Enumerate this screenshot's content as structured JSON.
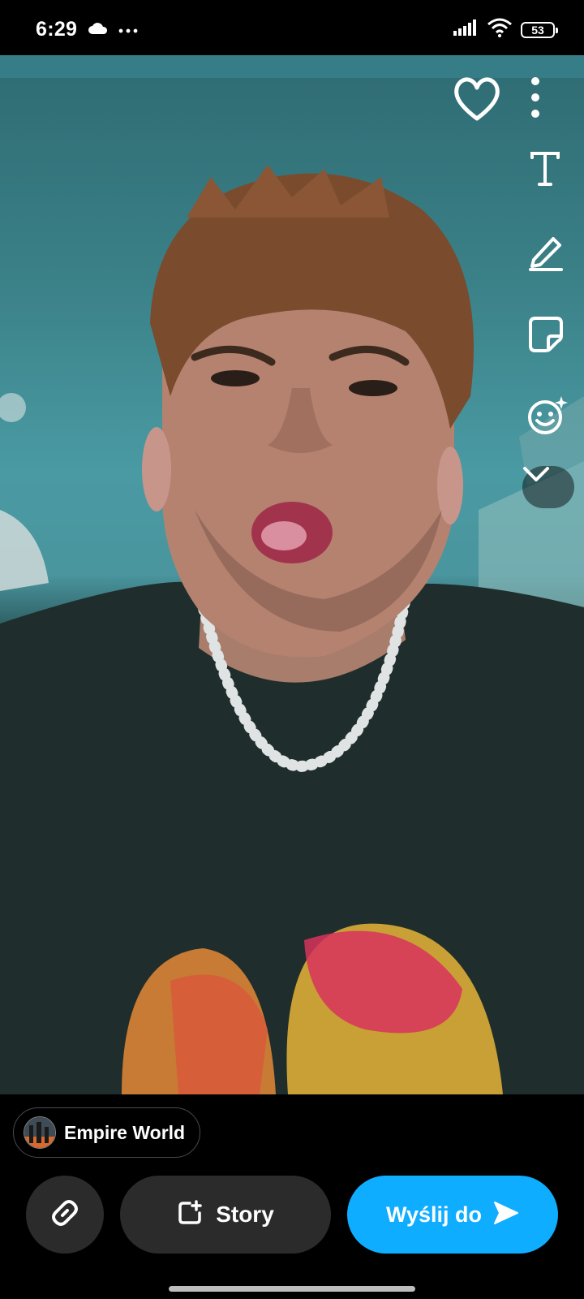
{
  "status_bar": {
    "time": "6:29",
    "battery": "53",
    "icons": [
      "cloud-icon",
      "more-dots-icon",
      "signal-icon",
      "wifi-icon",
      "battery-icon"
    ]
  },
  "toolbar": {
    "icons": [
      "heart-icon",
      "more-vert-icon",
      "text-tool-icon",
      "pencil-icon",
      "sticker-icon",
      "smiley-sparkle-icon",
      "chevron-down-icon"
    ]
  },
  "destination": {
    "label": "Empire World"
  },
  "actions": {
    "link_icon": "link-icon",
    "story_label": "Story",
    "send_label": "Wyślij do"
  },
  "colors": {
    "send_button": "#0fadff",
    "dark_button": "#2b2b2b"
  }
}
